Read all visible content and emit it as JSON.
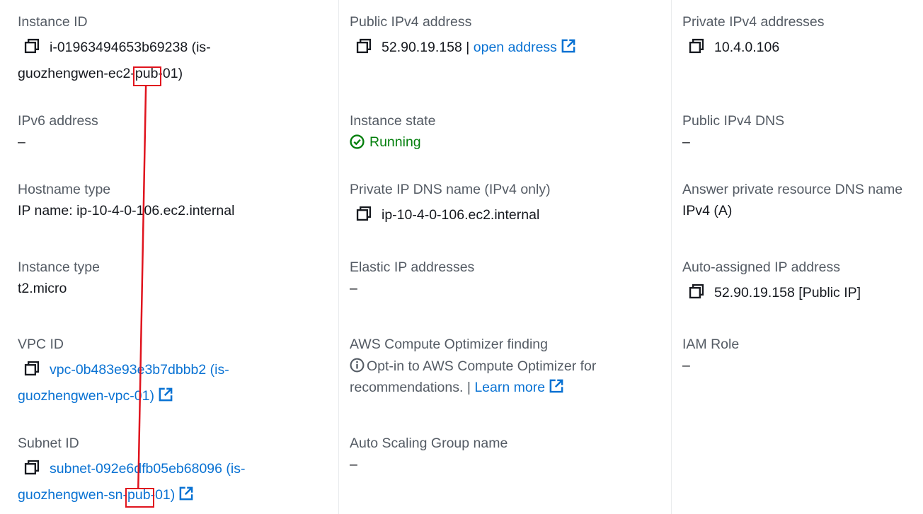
{
  "col1": {
    "instance_id_label": "Instance ID",
    "instance_id_line1": "i-01963494653b69238 (is-",
    "instance_id_line2_pre": "guozhengwen-ec2-",
    "instance_id_highlight": "pub",
    "instance_id_line2_post": "-01)",
    "ipv6_label": "IPv6 address",
    "ipv6_value": "–",
    "hostname_type_label": "Hostname type",
    "hostname_type_value": "IP name: ip-10-4-0-106.ec2.internal",
    "instance_type_label": "Instance type",
    "instance_type_value": "t2.micro",
    "vpc_label": "VPC ID",
    "vpc_line1": "vpc-0b483e93e3b7dbbb2 (is-",
    "vpc_line2": "guozhengwen-vpc-01)",
    "subnet_label": "Subnet ID",
    "subnet_line1": "subnet-092e6dfb05eb68096 (is-",
    "subnet_line2_pre": "guozhengwen-sn-",
    "subnet_highlight": "pub",
    "subnet_line2_post": "-01)"
  },
  "col2": {
    "public_ipv4_label": "Public IPv4 address",
    "public_ipv4_value": "52.90.19.158",
    "separator": " | ",
    "open_address_link": "open address",
    "instance_state_label": "Instance state",
    "instance_state_value": "Running",
    "private_dns_label": "Private IP DNS name (IPv4 only)",
    "private_dns_value": "ip-10-4-0-106.ec2.internal",
    "elastic_ip_label": "Elastic IP addresses",
    "elastic_ip_value": "–",
    "optimizer_label": "AWS Compute Optimizer finding",
    "optimizer_line1": "Opt-in to AWS Compute Optimizer for",
    "optimizer_line2": "recommendations.",
    "learn_more_link": "Learn more",
    "asg_label": "Auto Scaling Group name",
    "asg_value": "–"
  },
  "col3": {
    "private_ipv4_label": "Private IPv4 addresses",
    "private_ipv4_value": "10.4.0.106",
    "public_dns_label": "Public IPv4 DNS",
    "public_dns_value": "–",
    "answer_dns_label": "Answer private resource DNS name",
    "answer_dns_value": "IPv4 (A)",
    "auto_ip_label": "Auto-assigned IP address",
    "auto_ip_value": "52.90.19.158 [Public IP]",
    "iam_label": "IAM Role",
    "iam_value": "–"
  },
  "icons": {
    "copy": "copy-icon",
    "external": "external-link-icon",
    "status": "check-circle-icon",
    "info": "info-icon"
  },
  "colors": {
    "link": "#0972d3",
    "running": "#037f0c",
    "label": "#545b64",
    "text": "#16191f",
    "annotation": "#e0141e",
    "divider": "#e9ebed"
  }
}
